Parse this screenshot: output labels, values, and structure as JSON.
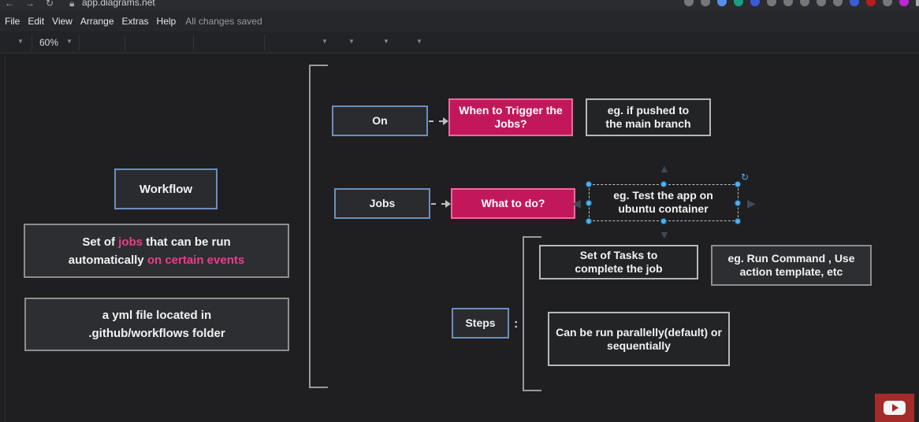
{
  "browser": {
    "url": "app.diagrams.net"
  },
  "menu": {
    "items": [
      "File",
      "Edit",
      "View",
      "Arrange",
      "Extras",
      "Help"
    ],
    "status": "All changes saved"
  },
  "toolbar": {
    "zoom": "60%"
  },
  "diagram": {
    "workflow": "Workflow",
    "definition": {
      "prefix": "Set of ",
      "jobs": "jobs",
      "middle": " that can be run automatically ",
      "events": "on certain events"
    },
    "yml": "a yml file located in .github/workflows folder",
    "on": "On",
    "on_trigger": "When to Trigger the Jobs?",
    "on_example": "eg.  if pushed to the main branch",
    "jobs": "Jobs",
    "jobs_what": "What to do?",
    "jobs_example": "eg. Test the app on ubuntu container",
    "steps": "Steps",
    "steps_colon": ":",
    "steps_tasks": "Set of Tasks to complete the job",
    "steps_example": "eg. Run Command , Use action template, etc",
    "steps_parallel": "Can be run parallelly(default) or sequentially"
  }
}
